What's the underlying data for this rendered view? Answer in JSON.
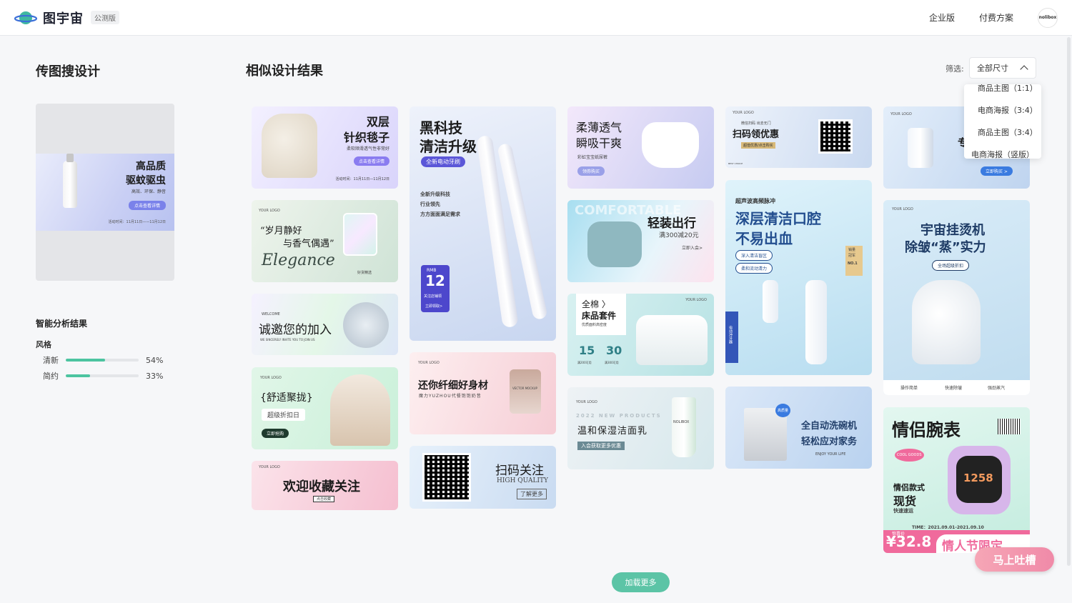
{
  "header": {
    "logo_text": "图宇宙",
    "beta_badge": "公测版",
    "nav": [
      "企业版",
      "付费方案"
    ],
    "avatar_text": "nolibox"
  },
  "left": {
    "title": "传图搜设计",
    "uploaded": {
      "line1": "高品质",
      "line2": "驱蚊驱虫",
      "sub": "高效、环保、静音",
      "button": "点击查看详情",
      "date": "活动时间：11月11日——11月12日"
    },
    "analysis_title": "智能分析结果",
    "style_label": "风格",
    "styles": [
      {
        "name": "清新",
        "value": 54,
        "label": "54%"
      },
      {
        "name": "简约",
        "value": 33,
        "label": "33%"
      }
    ]
  },
  "results": {
    "title": "相似设计结果",
    "filter_label": "筛选:",
    "filter_value": "全部尺寸",
    "dropdown": [
      "商品主图（1:1）",
      "电商海报（3:4）",
      "商品主图（3:4）",
      "电商海报（竖版）"
    ],
    "load_more": "加载更多"
  },
  "cards": {
    "c1": {
      "t1": "双层",
      "t2": "针织毯子",
      "sub": "柔软顺滑透气性非常好",
      "btn": "点击查看详情",
      "date": "活动时间：11月11日—11月12日"
    },
    "c2": {
      "logo": "YOUR LOGO",
      "l1": "“岁月静好",
      "l2": "与香气偶遇”",
      "script": "Elegance",
      "tag": "好货精选"
    },
    "c3": {
      "small": "WELCOME",
      "t": "诚邀您的加入",
      "sub": "WE SINCERELY INVITE YOU TO JOIN US"
    },
    "c4": {
      "logo": "YOUR LOGO",
      "t": "{舒适聚拢}",
      "tag": "超级折扣日",
      "btn": "立即抢购"
    },
    "c5": {
      "logo": "YOUR LOGO",
      "t": "欢迎收藏关注",
      "btn": "点击收藏"
    },
    "c6": {
      "t1": "黑科技",
      "t2": "清洁升级",
      "tag": "全新电动牙刷",
      "f1": "全新升级科技",
      "f2": "行业领先",
      "f3": "方方面面满足需求",
      "rmb": "RMB",
      "price": "12",
      "note": "关注店铺领",
      "btn": "立即领取>"
    },
    "c7": {
      "logo": "YOUR LOGO",
      "t": "还你纤细好身材",
      "sub": "魔力YUZHOU代餐饱饱奶昔",
      "jar": "VECTOR MOCKUP"
    },
    "c8": {
      "t": "扫码关注",
      "sub": "HIGH QUALITY",
      "btn": "了解更多"
    },
    "c9": {
      "t1": "柔薄透气",
      "t2": "瞬吸干爽",
      "sub": "彩虹宝宝纸尿裤",
      "btn": "领券购买"
    },
    "c10": {
      "bg": "COMFORTABLE",
      "t": "轻装出行",
      "sub": "满300减20元",
      "btn": "立即入会>"
    },
    "c11": {
      "logo": "YOUR LOGO",
      "t1": "全棉 〉",
      "t2": "床品套件",
      "sub": "优质面料高密度",
      "p1": "15",
      "p2": "30",
      "c1": "满200可用",
      "c2": "满300可用"
    },
    "c12": {
      "logo": "YOUR LOGO",
      "year": "2022 NEW PRODUCTS",
      "t": "温和保湿洁面乳",
      "tag": "入会获取更多优惠",
      "brand": "NOLIBOX"
    },
    "c13": {
      "logo": "YOUR LOGO",
      "l1": "微信扫码  出去无门",
      "t": "扫码领优惠",
      "tag": "超值优惠/点击购买",
      "foot": "BEST CHOICE"
    },
    "c14": {
      "small": "超声波高频脉冲",
      "t1": "深层清洁口腔",
      "t2": "不易出血",
      "tag1": "深入清洁盲区",
      "tag2": "柔和流动清力",
      "badge1": "销量",
      "badge2": "冠军",
      "badge3": "NO.1",
      "side": "电动冲牙器"
    },
    "c15": {
      "badge": "高质量",
      "t1": "全自动洗碗机",
      "t2": "轻松应对家务",
      "sub": "ENJOY YOUR LIFE"
    },
    "c16": {
      "logo": "YOUR LOGO",
      "t": "专",
      "btn": "立即购买 >"
    },
    "c17": {
      "logo": "YOUR LOGO",
      "t1": "宇宙挂烫机",
      "t2": "除皱“蒸”实力",
      "tag": "全场超级折扣",
      "f1": "操作简单",
      "f2": "快速除皱",
      "f3": "强劲蒸汽"
    },
    "c18": {
      "t": "情侣腕表",
      "badge": "COOL GOODS",
      "s1": "情侣款式",
      "s2": "现货",
      "s3": "快速速运",
      "time": "TIME：2021.09.01-2021.09.10",
      "price_label": "惊喜价",
      "price": "¥32.8",
      "promo": "情人节限定",
      "watch": "1258"
    }
  },
  "feedback": "马上吐槽",
  "colors": {
    "accent": "#5cc4a6",
    "bar": "#4cc4a0",
    "feedback": "#f08aa8"
  }
}
